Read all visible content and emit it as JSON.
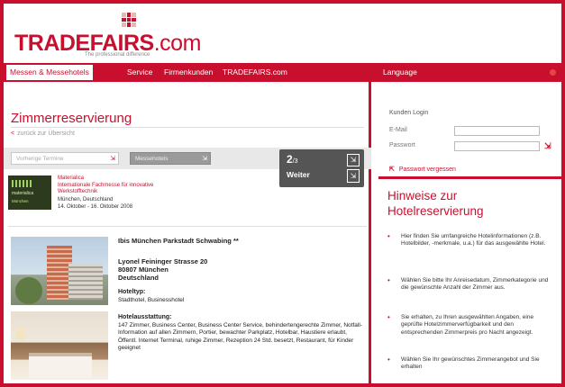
{
  "brand": {
    "logo_main": "TRADE",
    "logo_fairs": "FAIRS",
    "logo_com": ".com",
    "tagline": "The professional difference",
    "accent_color": "#c8102e"
  },
  "nav": {
    "items": [
      "Messen & Messehotels",
      "Service",
      "Firmenkunden",
      "TRADEFAIRS.com"
    ],
    "language": "Language"
  },
  "main": {
    "title": "Zimmerreservierung",
    "back_link": "zurück zur Übersicht",
    "filters": [
      {
        "value": "Vorherige Termine",
        "style": "light"
      },
      {
        "value": "Messehotels",
        "style": "dark"
      }
    ],
    "step": {
      "number": "2",
      "suffix": "/3",
      "weiter": "Weiter"
    },
    "event": {
      "logo_line1": "materialica",
      "logo_line2": "München",
      "name": "Materialica",
      "description": "Internationale Fachmesse für innovative Werkstofftechnik",
      "location": "München, Deutschland",
      "date": "14. Oktober - 16. Oktober 2008"
    },
    "hotel": {
      "name": "Ibis München Parkstadt Schwabing **",
      "address_lines": [
        "Lyonel Feininger Strasse 20",
        "80807 München",
        "Deutschland"
      ],
      "type_label": "Hoteltyp:",
      "type": "Stadthotel, Businesshotel",
      "amenities_label": "Hotelausstattung:",
      "amenities": "147 Zimmer, Business Center, Business Center Service, behindertengerechte Zimmer, Notfall-Information auf allen Zimmern, Portier, bewachter Parkplatz, Hotelbar, Haustiere erlaubt, Öffentl. Internet Terminal, ruhige Zimmer, Rezeption 24 Std. besetzt, Restaurant, für Kinder geeignet"
    }
  },
  "sidebar": {
    "login_title": "Kunden Login",
    "email_label": "E-Mail",
    "password_label": "Passwort",
    "forgot": "Passwort vergessen",
    "hint_title": "Hinweise zur Hotelreservierung",
    "hints": [
      "Hier finden Sie umfangreiche Hotelinformationen (z.B. Hotelbilder, -merkmale, u.a.) für das ausgewählte Hotel.",
      "Wählen Sie bitte Ihr Anreisedatum, Zimmerkategorie und die gewünschte Anzahl der Zimmer aus.",
      "Sie erhalten, zu Ihren ausgewählten Angaben, eine geprüfte Hotelzimmerverfügbarkeit und den entsprechenden Zimmerpreis pro Nacht angezeigt.",
      "Wählen Sie Ihr gewünschtes Zimmerangebot und Sie erhalten"
    ]
  }
}
